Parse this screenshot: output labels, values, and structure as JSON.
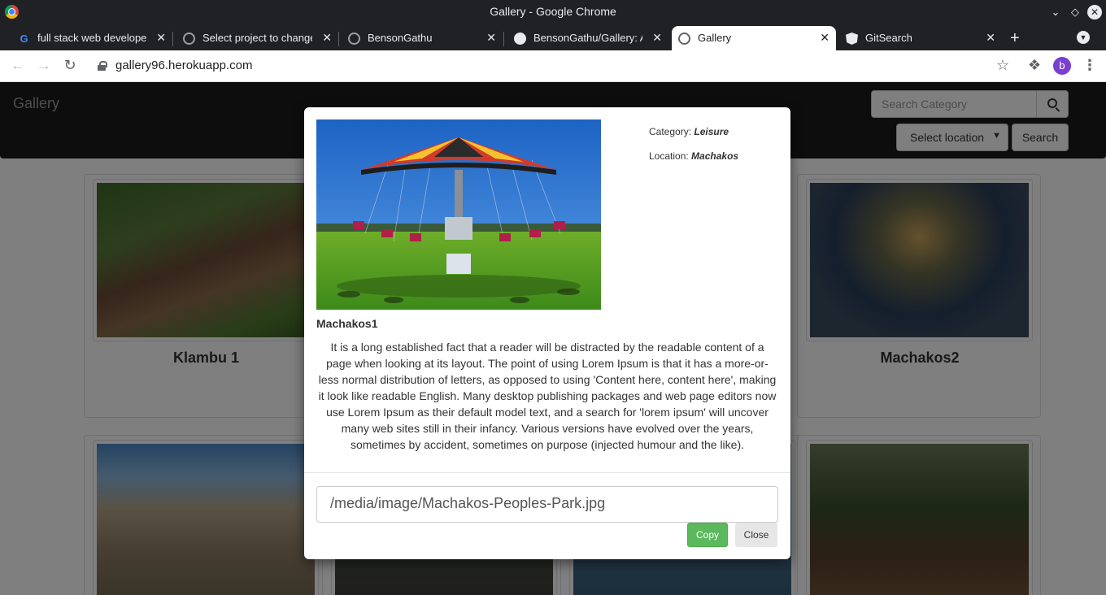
{
  "window": {
    "title": "Gallery - Google Chrome"
  },
  "tabs": [
    {
      "label": "full stack web developer",
      "icon": "google-icon"
    },
    {
      "label": "Select project to change",
      "icon": "globe-icon"
    },
    {
      "label": "BensonGathu",
      "icon": "globe-icon"
    },
    {
      "label": "BensonGathu/Gallery: A",
      "icon": "github-icon"
    },
    {
      "label": "Gallery",
      "icon": "globe-icon",
      "active": true
    },
    {
      "label": "GitSearch",
      "icon": "angular-icon"
    }
  ],
  "toolbar": {
    "url": "gallery96.herokuapp.com",
    "profile_initial": "b"
  },
  "site": {
    "brand": "Gallery",
    "search_placeholder": "Search Category",
    "location_select": "Select location",
    "search_button": "Search"
  },
  "cards": [
    {
      "title": "Klambu 1"
    },
    {
      "title": "Machakos2"
    }
  ],
  "modal": {
    "category_label": "Category:",
    "category_value": "Leisure",
    "location_label": "Location:",
    "location_value": "Machakos",
    "image_name": "Machakos1",
    "description": "It is a long established fact that a reader will be distracted by the readable content of a page when looking at its layout. The point of using Lorem Ipsum is that it has a more-or-less normal distribution of letters, as opposed to using 'Content here, content here', making it look like readable English. Many desktop publishing packages and web page editors now use Lorem Ipsum as their default model text, and a search for 'lorem ipsum' will uncover many web sites still in their infancy. Various versions have evolved over the years, sometimes by accident, sometimes on purpose (injected humour and the like).",
    "image_path": "/media/image/Machakos-Peoples-Park.jpg",
    "copy_button": "Copy",
    "close_button": "Close"
  },
  "colors": {
    "copy_button": "#5cb85c",
    "navbar": "#1a1a1a",
    "profile": "#7b3fd0"
  }
}
